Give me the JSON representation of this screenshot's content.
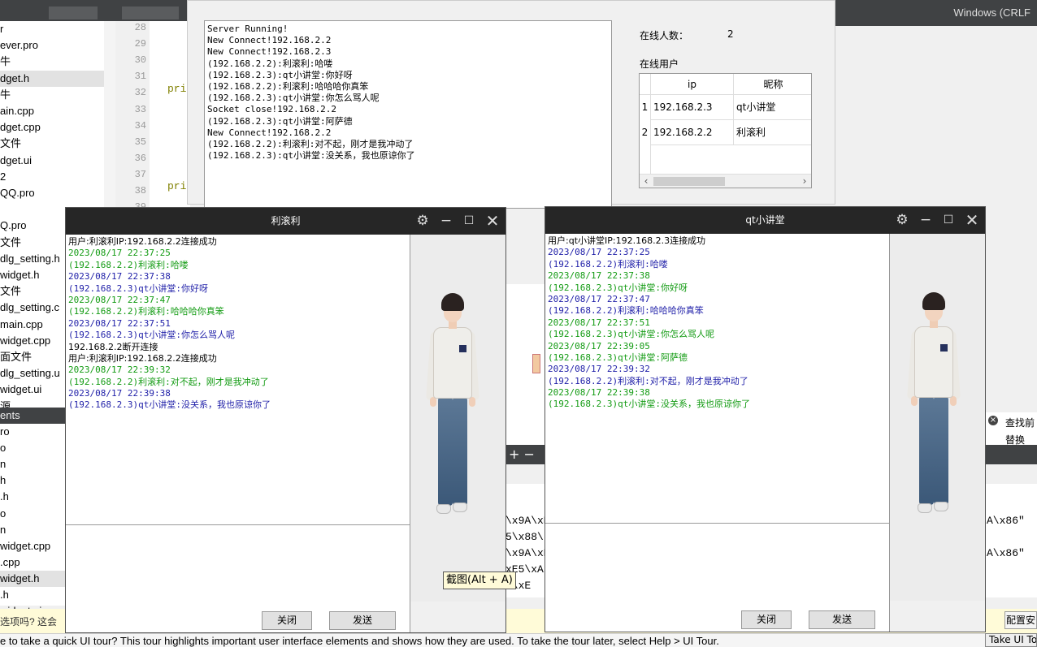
{
  "ide": {
    "encoding": "Windows (CRLF",
    "tree_items": [
      "r",
      "ever.pro",
      "牛",
      "dget.h",
      "牛",
      "ain.cpp",
      "dget.cpp",
      "文件",
      "dget.ui",
      "2",
      "QQ.pro",
      "",
      "Q.pro",
      "文件",
      "dlg_setting.h",
      "widget.h",
      "文件",
      "dlg_setting.c",
      "main.cpp",
      "widget.cpp",
      "面文件",
      "dlg_setting.u",
      "widget.ui",
      "源"
    ],
    "open_docs_header": "ents",
    "open_docs": [
      "ro",
      "o",
      "n",
      "h",
      ".h",
      "o",
      "n",
      "widget.cpp",
      ".cpp",
      "widget.h",
      ".h",
      "widget.ui"
    ],
    "line_numbers": [
      "28",
      "29",
      "30",
      "31",
      "32",
      "33",
      "34",
      "35",
      "36",
      "37",
      "38",
      "39"
    ],
    "keywords": [
      "pri",
      "pri"
    ],
    "question_text": "选项吗? 这会",
    "tour_text": "e to take a quick UI tour? This tour highlights important user interface elements and shows how they are used. To take the tour later, select Help > UI Tour.",
    "tour_button": "Take UI To",
    "config_button": "配置安",
    "find_label": "查找前",
    "replace_label": "替换",
    "mid_plus_minus": "+ −",
    "mid_code": [
      "\\x9A\\xE",
      "5\\x88\\",
      "\\x9A\\xE",
      "xE5\\xA(",
      "1\\xE"
    ],
    "right_code": [
      "A\\x86\"",
      "",
      "A\\x86\""
    ]
  },
  "server": {
    "log": [
      "Server Running!",
      "New Connect!192.168.2.2",
      "New Connect!192.168.2.3",
      "(192.168.2.2):利滚利:哈喽",
      "(192.168.2.3):qt小讲堂:你好呀",
      "(192.168.2.2):利滚利:哈哈哈你真笨",
      "(192.168.2.3):qt小讲堂:你怎么骂人呢",
      "Socket close!192.168.2.2",
      "(192.168.2.3):qt小讲堂:阿萨德",
      "New Connect!192.168.2.2",
      "(192.168.2.2):利滚利:对不起，刚才是我冲动了",
      "(192.168.2.3):qt小讲堂:没关系，我也原谅你了"
    ],
    "online_count_label": "在线人数：",
    "online_count": "2",
    "online_users_label": "在线用户",
    "table": {
      "headers": [
        "ip",
        "昵称"
      ],
      "rows": [
        {
          "num": "1",
          "ip": "192.168.2.3",
          "nick": "qt小讲堂"
        },
        {
          "num": "2",
          "ip": "192.168.2.2",
          "nick": "利滚利"
        }
      ]
    }
  },
  "chat_left": {
    "title": "利滚利",
    "messages": [
      {
        "t": "用户:利滚利IP:192.168.2.2连接成功",
        "c": "blk"
      },
      {
        "t": "2023/08/17 22:37:25",
        "c": "g"
      },
      {
        "t": "(192.168.2.2)利滚利:哈喽",
        "c": "g"
      },
      {
        "t": "2023/08/17 22:37:38",
        "c": "b"
      },
      {
        "t": "(192.168.2.3)qt小讲堂:你好呀",
        "c": "b"
      },
      {
        "t": "2023/08/17 22:37:47",
        "c": "g"
      },
      {
        "t": "(192.168.2.2)利滚利:哈哈哈你真笨",
        "c": "g"
      },
      {
        "t": "2023/08/17 22:37:51",
        "c": "b"
      },
      {
        "t": "(192.168.2.3)qt小讲堂:你怎么骂人呢",
        "c": "b"
      },
      {
        "t": "192.168.2.2断开连接",
        "c": "blk"
      },
      {
        "t": "用户:利滚利IP:192.168.2.2连接成功",
        "c": "blk"
      },
      {
        "t": "2023/08/17 22:39:32",
        "c": "g"
      },
      {
        "t": "(192.168.2.2)利滚利:对不起，刚才是我冲动了",
        "c": "g"
      },
      {
        "t": "2023/08/17 22:39:38",
        "c": "b"
      },
      {
        "t": "(192.168.2.3)qt小讲堂:没关系，我也原谅你了",
        "c": "b"
      }
    ],
    "close_label": "关闭",
    "send_label": "发送"
  },
  "chat_right": {
    "title": "qt小讲堂",
    "messages": [
      {
        "t": "用户:qt小讲堂IP:192.168.2.3连接成功",
        "c": "blk"
      },
      {
        "t": "2023/08/17 22:37:25",
        "c": "b"
      },
      {
        "t": "(192.168.2.2)利滚利:哈喽",
        "c": "b"
      },
      {
        "t": "2023/08/17 22:37:38",
        "c": "g"
      },
      {
        "t": "(192.168.2.3)qt小讲堂:你好呀",
        "c": "g"
      },
      {
        "t": "2023/08/17 22:37:47",
        "c": "b"
      },
      {
        "t": "(192.168.2.2)利滚利:哈哈哈你真笨",
        "c": "b"
      },
      {
        "t": "2023/08/17 22:37:51",
        "c": "g"
      },
      {
        "t": "(192.168.2.3)qt小讲堂:你怎么骂人呢",
        "c": "g"
      },
      {
        "t": "2023/08/17 22:39:05",
        "c": "g"
      },
      {
        "t": "(192.168.2.3)qt小讲堂:阿萨德",
        "c": "g"
      },
      {
        "t": "2023/08/17 22:39:32",
        "c": "b"
      },
      {
        "t": "(192.168.2.2)利滚利:对不起，刚才是我冲动了",
        "c": "b"
      },
      {
        "t": "2023/08/17 22:39:38",
        "c": "g"
      },
      {
        "t": "(192.168.2.3)qt小讲堂:没关系，我也原谅你了",
        "c": "g"
      }
    ],
    "close_label": "关闭",
    "send_label": "发送"
  },
  "tooltip": "截图(Alt + A)",
  "colors": {
    "self_msg": "#139b13",
    "other_msg": "#1f1fa8",
    "titlebar": "#262626"
  }
}
